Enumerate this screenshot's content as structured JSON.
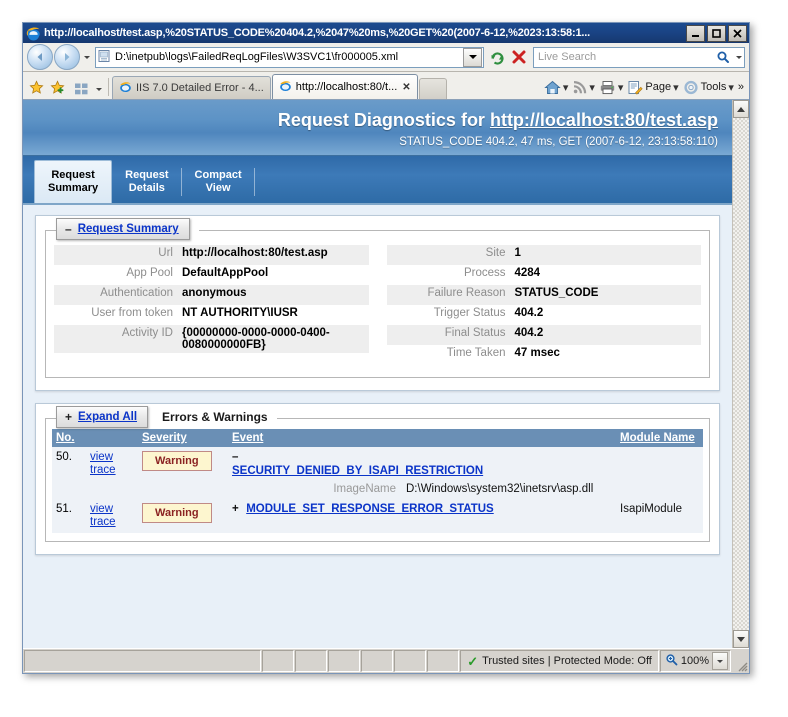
{
  "window": {
    "title": "http://localhost/test.asp,%20STATUS_CODE%20404.2,%2047%20ms,%20GET%20(2007-6-12,%2023:13:58:1...",
    "minimize_label": "_",
    "maximize_label": "□",
    "close_label": "✕",
    "app_icon": "internet-explorer-icon"
  },
  "address_bar": {
    "back_label": "◄",
    "forward_label": "►",
    "url": "D:\\inetpub\\logs\\FailedReqLogFiles\\W3SVC1\\fr000005.xml",
    "refresh_icon": "refresh-icon",
    "stop_icon": "stop-icon",
    "search_placeholder": "Live Search",
    "search_icon": "search-icon"
  },
  "command_bar": {
    "favorites_icon": "star-icon",
    "add_favorite_icon": "star-plus-icon",
    "favorites_center_icon": "quick-tabs-icon",
    "tabs": [
      {
        "label": "IIS 7.0 Detailed Error - 4...",
        "active": false
      },
      {
        "label": "http://localhost:80/t...",
        "active": true,
        "close_label": "✕"
      }
    ],
    "tools": [
      {
        "name": "home-icon",
        "label": ""
      },
      {
        "name": "feeds-icon",
        "label": ""
      },
      {
        "name": "print-icon",
        "label": ""
      },
      {
        "name": "page-icon",
        "label": "Page"
      },
      {
        "name": "tools-icon",
        "label": "Tools"
      }
    ],
    "overflow_label": "»"
  },
  "report": {
    "header": {
      "title_prefix": "Request Diagnostics for ",
      "title_url": "http://localhost:80/test.asp",
      "subtitle": "STATUS_CODE 404.2, 47 ms, GET (2007-6-12, 23:13:58:110)"
    },
    "tabs": [
      {
        "line1": "Request",
        "line2": "Summary",
        "active": true
      },
      {
        "line1": "Request",
        "line2": "Details",
        "active": false
      },
      {
        "line1": "Compact",
        "line2": "View",
        "active": false
      }
    ],
    "summary_panel": {
      "toggle_sign": "–",
      "legend_label": "Request Summary",
      "left_rows": [
        {
          "key": "Url",
          "value": "http://localhost:80/test.asp"
        },
        {
          "key": "App Pool",
          "value": "DefaultAppPool"
        },
        {
          "key": "Authentication",
          "value": "anonymous"
        },
        {
          "key": "User from token",
          "value": "NT AUTHORITY\\IUSR"
        },
        {
          "key": "Activity ID",
          "value": "{00000000-0000-0000-0400-0080000000FB}"
        }
      ],
      "right_rows": [
        {
          "key": "Site",
          "value": "1"
        },
        {
          "key": "Process",
          "value": "4284"
        },
        {
          "key": "Failure Reason",
          "value": "STATUS_CODE"
        },
        {
          "key": "Trigger Status",
          "value": "404.2"
        },
        {
          "key": "Final Status",
          "value": "404.2"
        },
        {
          "key": "Time Taken",
          "value": "47 msec"
        }
      ]
    },
    "errors_panel": {
      "toggle_sign": "+",
      "legend_label": "Expand All",
      "legend_note": "Errors & Warnings",
      "columns": [
        "No.",
        "",
        "Severity",
        "Event",
        "Module Name"
      ],
      "col_no": "No.",
      "col_severity": "Severity",
      "col_event": "Event",
      "col_module": "Module Name",
      "rows": [
        {
          "no": "50.",
          "view": "view",
          "trace": "trace",
          "severity": "Warning",
          "toggle": "–",
          "event": "SECURITY_DENIED_BY_ISAPI_RESTRICTION",
          "module": "",
          "detail_key": "ImageName",
          "detail_value": "D:\\Windows\\system32\\inetsrv\\asp.dll"
        },
        {
          "no": "51.",
          "view": "view",
          "trace": "trace",
          "severity": "Warning",
          "toggle": "+",
          "event": "MODULE_SET_RESPONSE_ERROR_STATUS",
          "module": "IsapiModule",
          "detail_key": "",
          "detail_value": ""
        }
      ]
    }
  },
  "status_bar": {
    "message": "",
    "zone": "Trusted sites | Protected Mode: Off",
    "zone_icon": "trusted-sites-check-icon",
    "zoom_icon": "zoom-magnifier-icon",
    "zoom_level": "100%"
  },
  "colors": {
    "title_bar": "#1a4485",
    "header_blue": "#5d93c6",
    "tab_strip": "#2f6aa8",
    "table_header": "#6a8fb5",
    "link": "#0b34c8",
    "warning_bg": "#fdf6cf",
    "warning_text": "#8a2222"
  }
}
